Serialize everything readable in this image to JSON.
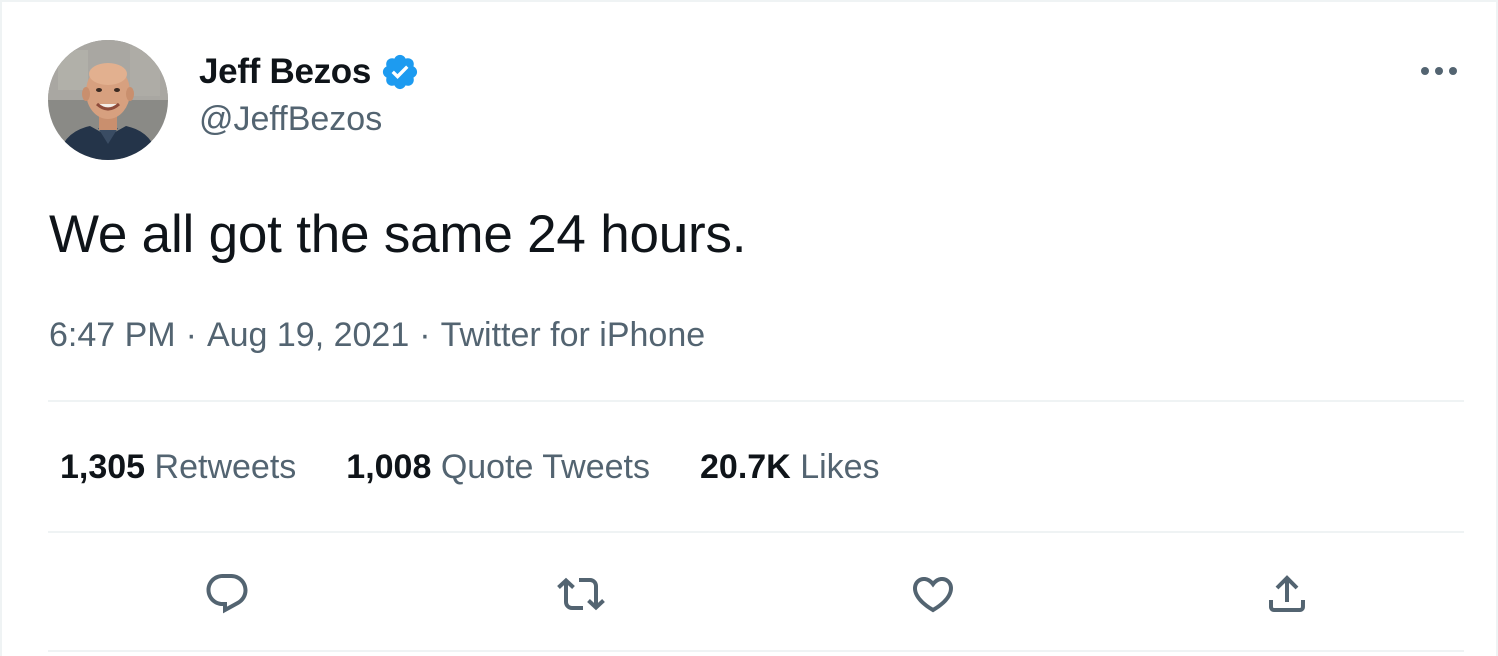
{
  "author": {
    "display_name": "Jeff Bezos",
    "handle": "@JeffBezos",
    "verified": true,
    "avatar_icon": "profile-photo"
  },
  "tweet": {
    "text": "We all got the same 24 hours.",
    "time": "6:47 PM",
    "date": "Aug 19, 2021",
    "source": "Twitter for iPhone",
    "separator": "·"
  },
  "stats": {
    "retweets": {
      "count": "1,305",
      "label": "Retweets"
    },
    "quote_tweets": {
      "count": "1,008",
      "label": "Quote Tweets"
    },
    "likes": {
      "count": "20.7K",
      "label": "Likes"
    }
  },
  "actions": {
    "reply_icon": "reply-icon",
    "retweet_icon": "retweet-icon",
    "like_icon": "heart-icon",
    "share_icon": "share-icon",
    "more_icon": "more-icon"
  },
  "colors": {
    "text_primary": "#0f1419",
    "text_secondary": "#536471",
    "verified_blue": "#1d9bf0",
    "divider": "#eff3f4"
  }
}
